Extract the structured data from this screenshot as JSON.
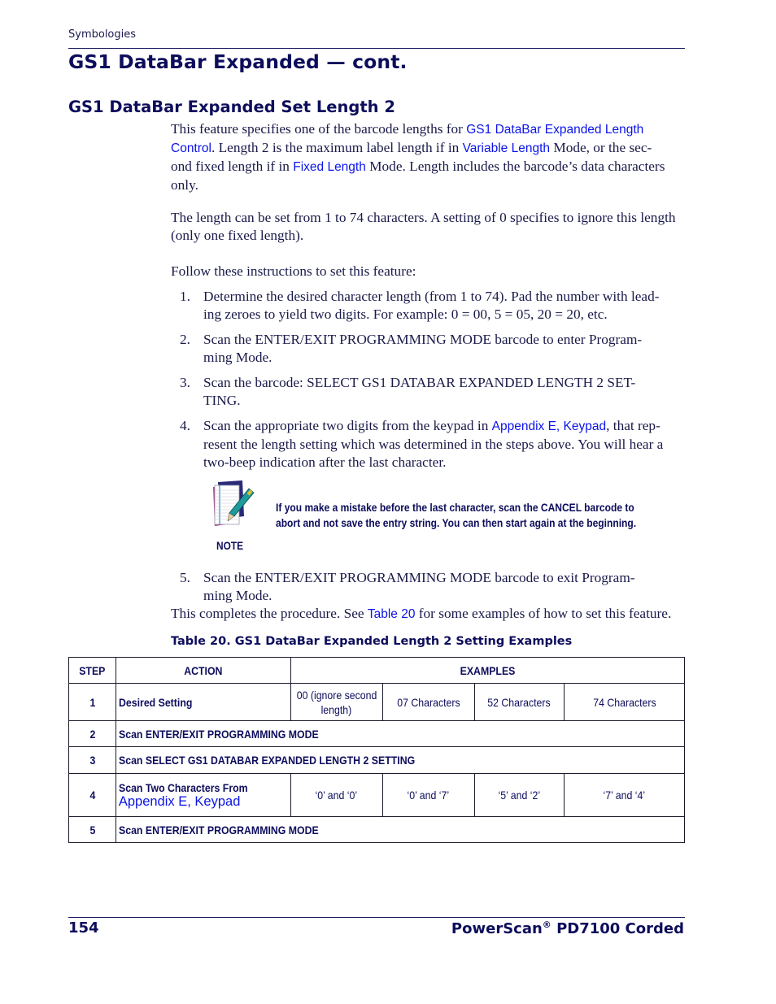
{
  "header": {
    "breadcrumb": "Symbologies",
    "title": "GS1 DataBar Expanded — cont."
  },
  "section": {
    "title": "GS1 DataBar Expanded Set Length 2",
    "para1": {
      "t1": "This feature specifies one of the barcode lengths for ",
      "link1": "GS1 DataBar Expanded Length",
      "link1b": "Control",
      "t2": ". Length 2 is the maximum label length if in ",
      "link2": "Variable Length",
      "t3": " Mode, or the sec-",
      "t4": "ond fixed length if in ",
      "link3": "Fixed Length",
      "t5": " Mode.  Length includes the barcode’s data characters",
      "t6": "only."
    },
    "para2": {
      "line1": "The length can be set from 1 to 74 characters. A setting of 0 specifies to ignore this length",
      "line2": "(only one fixed length)."
    },
    "para3": "Follow these instructions to set this feature:",
    "steps": [
      {
        "num": "1.",
        "line1": "Determine the desired character length (from 1 to 74). Pad the number with lead-",
        "line2": "ing zeroes to yield two digits. For example: 0 = 00, 5 = 05, 20 = 20, etc."
      },
      {
        "num": "2.",
        "line1": "Scan the ENTER/EXIT PROGRAMMING MODE barcode to enter Program-",
        "line2": "ming Mode."
      },
      {
        "num": "3.",
        "line1": "Scan the barcode: SELECT GS1 DATABAR EXPANDED LENGTH 2 SET-",
        "line2": "TING."
      },
      {
        "num": "4.",
        "line1a": "Scan the appropriate two digits from the keypad in ",
        "link": "Appendix E, Keypad",
        "line1b": ", that rep-",
        "line2": "resent the length setting which was determined in the steps above. You will hear a",
        "line3": "two-beep indication after the last character."
      },
      {
        "num": "5.",
        "line1": "Scan the ENTER/EXIT PROGRAMMING MODE barcode to exit Program-",
        "line2": "ming Mode."
      }
    ],
    "note": {
      "label": "NOTE",
      "icon": "notepad-pen-icon",
      "line1": "If you make a mistake before the last character, scan the CANCEL barcode to",
      "line2": "abort and not save the entry string. You can then start again at the beginning."
    },
    "closing": {
      "t1": "This completes the procedure. See ",
      "link": "Table 20",
      "t2": " for some examples of how to set this feature."
    }
  },
  "table": {
    "caption": "Table 20. GS1 DataBar Expanded Length 2 Setting Examples",
    "headers": {
      "step": "STEP",
      "action": "ACTION",
      "examples": "EXAMPLES"
    },
    "rows": [
      {
        "step": "1",
        "action": "Desired Setting",
        "examples": [
          "00 (ignore second",
          "length)",
          "07 Characters",
          "52 Characters",
          "74 Characters"
        ]
      },
      {
        "step": "2",
        "action": "Scan ENTER/EXIT PROGRAMMING MODE"
      },
      {
        "step": "3",
        "action": "Scan SELECT GS1 DATABAR EXPANDED LENGTH 2 SETTING"
      },
      {
        "step": "4",
        "action": "Scan Two Characters From",
        "action_link": "Appendix E, Keypad",
        "examples": [
          "‘0’ and ‘0’",
          "‘0’ and ‘7’",
          "‘5’ and ‘2’",
          "‘7’ and ‘4’"
        ]
      },
      {
        "step": "5",
        "action": "Scan ENTER/EXIT PROGRAMMING MODE"
      }
    ]
  },
  "footer": {
    "page_number": "154",
    "product": "PowerScan",
    "registered": "®",
    "product_suffix": " PD7100 Corded"
  },
  "colors": {
    "heading": "#0d0d5c",
    "link": "#0b14e8",
    "body": "#1a1a4a"
  }
}
